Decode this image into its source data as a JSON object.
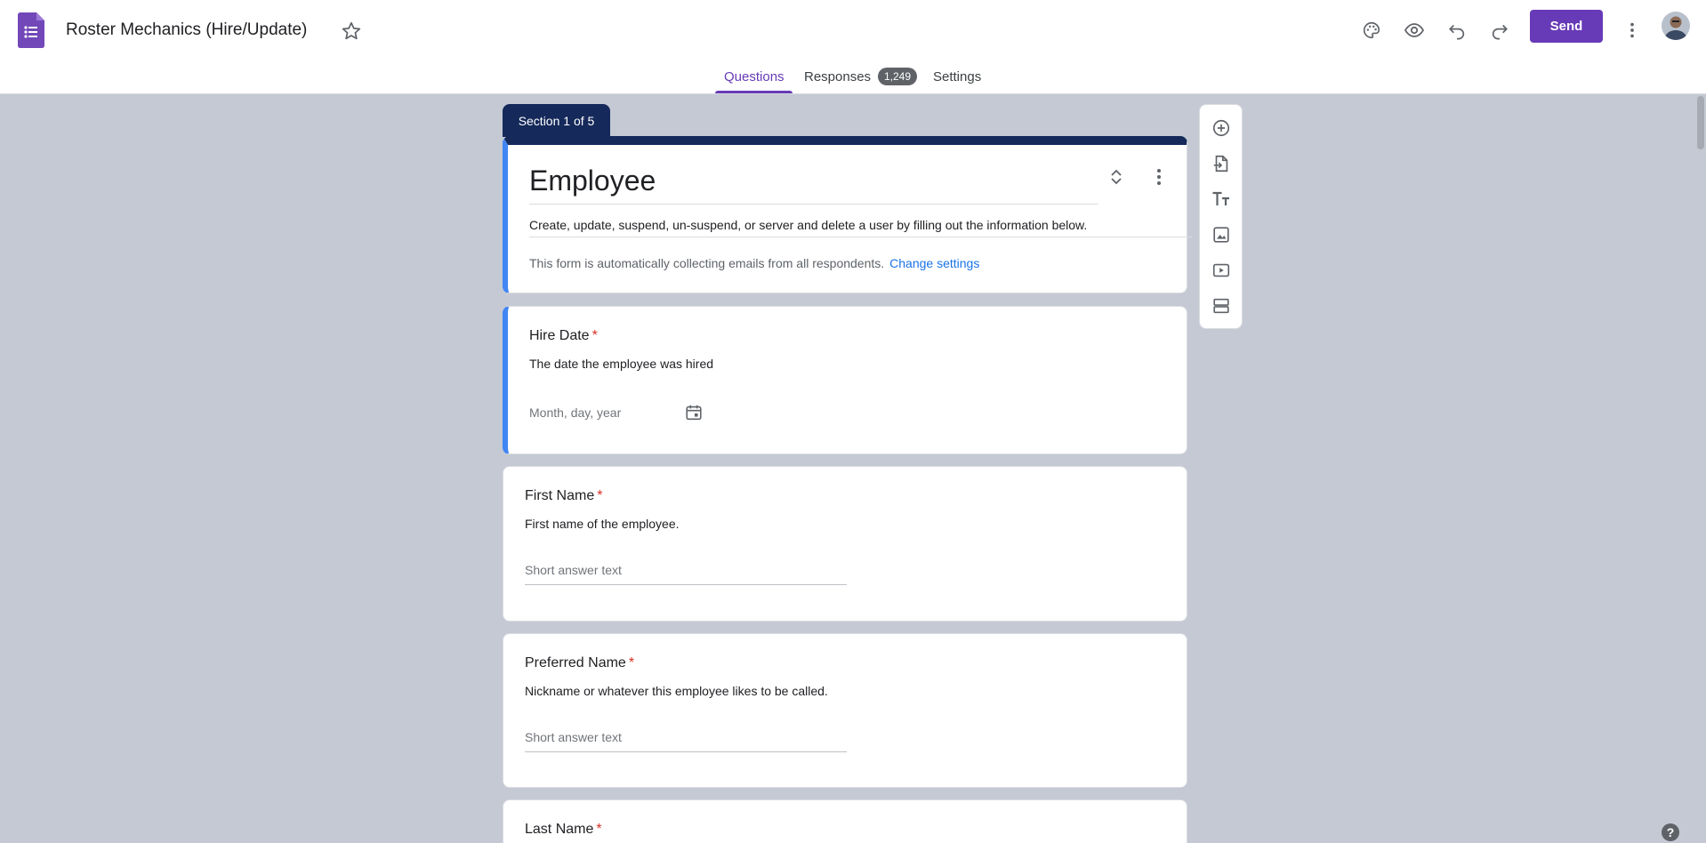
{
  "app": {
    "title": "Roster Mechanics (Hire/Update)",
    "logo_icon": "forms-icon"
  },
  "header": {
    "icons": [
      "palette-icon",
      "preview-eye-icon",
      "undo-icon",
      "redo-icon"
    ],
    "send_label": "Send",
    "more_icon": "more-vert-icon"
  },
  "tabs": [
    {
      "label": "Questions"
    },
    {
      "label": "Responses"
    },
    {
      "label": "Settings"
    }
  ],
  "responses_count": "1,249",
  "section": {
    "label": "Section 1 of 5"
  },
  "form": {
    "title": "Employee",
    "description": "Create, update, suspend, un-suspend, or server and delete a user by filling out the information below.",
    "email_note": "This form is automatically collecting emails from all respondents.",
    "change_settings": "Change settings"
  },
  "questions": [
    {
      "title": "Hire Date",
      "required_mark": "*",
      "description": "The date the employee was hired",
      "placeholder": "Month, day, year"
    },
    {
      "title": "First Name",
      "required_mark": "*",
      "description": "First name of the employee.",
      "placeholder": "Short answer text"
    },
    {
      "title": "Preferred Name",
      "required_mark": "*",
      "description": "Nickname or whatever this employee likes to be called.",
      "placeholder": "Short answer text"
    },
    {
      "title": "Last Name",
      "required_mark": "*"
    }
  ],
  "toolbar": [
    "add-question-icon",
    "import-questions-icon",
    "add-title-icon",
    "add-image-icon",
    "add-video-icon",
    "add-section-icon"
  ],
  "help": "?",
  "colors": {
    "accent": "#673ab7",
    "section": "#15295a",
    "active_border": "#4285f4",
    "link": "#1a73e8",
    "required": "#d93025"
  }
}
